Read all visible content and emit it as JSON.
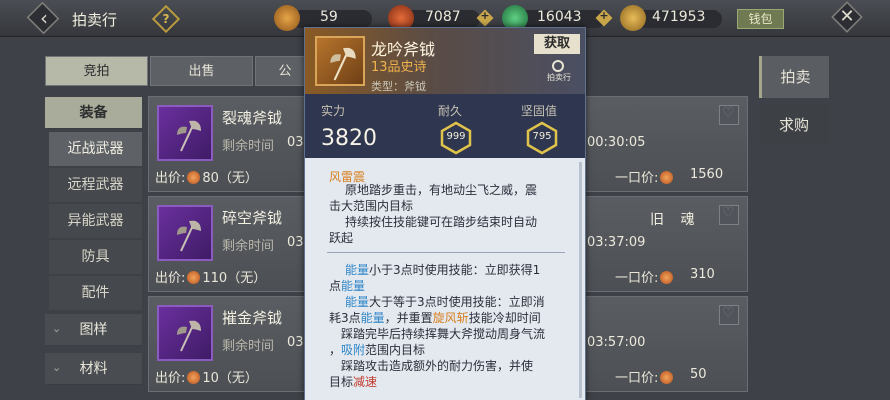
{
  "header": {
    "title": "拍卖行",
    "help": "?",
    "back_icon": "back-arrow-icon",
    "close": "✕",
    "currencies": [
      {
        "icon": "bag-icon",
        "value": "59",
        "color": "#c9852c",
        "plus": false
      },
      {
        "icon": "gem-icon",
        "value": "7087",
        "color": "#c45028",
        "plus": true
      },
      {
        "icon": "jade-icon",
        "value": "16043",
        "color": "#3aa05a",
        "plus": true
      },
      {
        "icon": "coin-bar-icon",
        "value": "471953",
        "color": "#c99a3a",
        "plus": false
      }
    ],
    "plus_glyph": "+",
    "wallet": "钱包"
  },
  "tabs": [
    {
      "label": "竞拍",
      "active": true
    },
    {
      "label": "出售",
      "active": false
    },
    {
      "label": "公",
      "active": false
    }
  ],
  "sidebar": {
    "category": "装备",
    "subitems": [
      {
        "label": "近战武器",
        "active": true
      },
      {
        "label": "远程武器",
        "active": false
      },
      {
        "label": "异能武器",
        "active": false
      },
      {
        "label": "防具",
        "active": false
      },
      {
        "label": "配件",
        "active": false
      }
    ],
    "collapsed": [
      {
        "label": "图样",
        "chevron": "⌄"
      },
      {
        "label": "材料",
        "chevron": "⌄"
      }
    ]
  },
  "right_tabs": [
    {
      "label": "拍卖",
      "active": true
    },
    {
      "label": "求购",
      "active": false
    }
  ],
  "items": [
    {
      "name": "裂魂斧钺",
      "time_label": "剩余时间",
      "time_left_partial": "03",
      "time_right": "00:30:05",
      "bid_label": "出价:",
      "bid": "80（无）",
      "buyout_label": "一口价:",
      "buyout": "1560",
      "tag": ""
    },
    {
      "name": "碎空斧钺",
      "time_label": "剩余时间",
      "time_left_partial": "03",
      "time_right": "03:37:09",
      "bid_label": "出价:",
      "bid": "110（无）",
      "buyout_label": "一口价:",
      "buyout": "310",
      "tag": "旧 魂"
    },
    {
      "name": "摧金斧钺",
      "time_label": "剩余时间",
      "time_left_partial": "03",
      "time_right": "03:57:00",
      "bid_label": "出价:",
      "bid": "10（无）",
      "buyout_label": "一口价:",
      "buyout": "50",
      "tag": ""
    }
  ],
  "popup": {
    "name": "龙吟斧钺",
    "grade": "13品史诗",
    "type": "类型：斧钺",
    "fetch": "获取",
    "auction_label": "拍卖行",
    "strength_label": "实力",
    "strength": "3820",
    "durability_label": "耐久",
    "durability": "999",
    "solidity_label": "坚固值",
    "solidity": "795",
    "skill_name": "风雷震",
    "skill_desc_1": "原地踏步重击，有地动尘飞之威，震",
    "skill_desc_2": "击大范围内目标",
    "skill_desc_3": "持续按住技能键可在踏步结束时自动",
    "skill_desc_4": "跃起",
    "energy_1a": "能量",
    "energy_1b": "小于3点时使用技能：立即获得1",
    "energy_1c": "点",
    "energy_1d": "能量",
    "energy_2a": "能量",
    "energy_2b": "大于等于3点时使用技能：立即消",
    "energy_2c": "耗3点",
    "energy_2d": "能量",
    "energy_2e": "，并重置",
    "energy_2f": "旋风斩",
    "energy_2g": "技能冷却时间",
    "stomp_1": "踩踏完毕后持续挥舞大斧搅动周身气流",
    "stomp_2a": "，",
    "stomp_2b": "吸附",
    "stomp_2c": "范围内目标",
    "stomp_3": "踩踏攻击造成额外的耐力伤害，并使",
    "stomp_4a": "目标",
    "stomp_4b": "减速"
  }
}
